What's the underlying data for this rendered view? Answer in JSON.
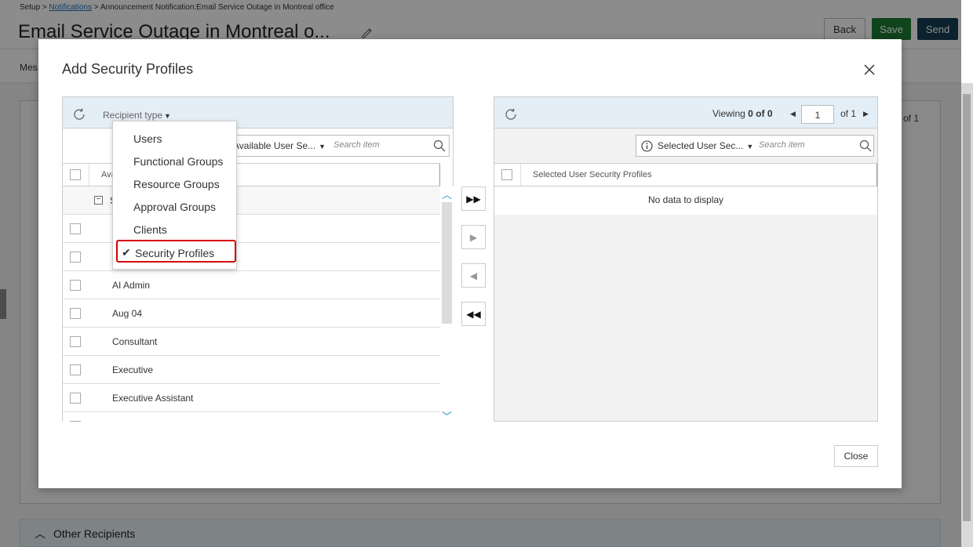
{
  "breadcrumb": {
    "root": "Setup",
    "sep1": ">",
    "link": "Notifications",
    "sep2": ">",
    "current": "Announcement Notification:Email Service Outage in Montreal office"
  },
  "page": {
    "title": "Email Service Outage in Montreal o...",
    "back_label": "Back",
    "save_label": "Save",
    "send_label": "Send",
    "tab_label_partial": "Mes",
    "other_recipients": "Other Recipients",
    "bg_pager": "of 1"
  },
  "modal": {
    "title": "Add Security Profiles",
    "close_label": "Close"
  },
  "left_panel": {
    "recipient_type_label": "Recipient type",
    "dropdown_label": "Available User Se...",
    "search_placeholder": "Search item",
    "column_header": "Ava",
    "group_label": "S",
    "rows": [
      "",
      "",
      "AI Admin",
      "Aug 04",
      "Consultant",
      "Executive",
      "Executive Assistant"
    ]
  },
  "right_panel": {
    "viewing_prefix": "Viewing",
    "viewing_count": "0 of 0",
    "page_number": "1",
    "page_of": "of 1",
    "dropdown_label": "Selected User Sec...",
    "search_placeholder": "Search item",
    "column_header": "Selected User Security Profiles",
    "no_data": "No data to display"
  },
  "recipient_menu": {
    "items": [
      "Users",
      "Functional Groups",
      "Resource Groups",
      "Approval Groups",
      "Clients",
      "Security Profiles"
    ],
    "selected": "Security Profiles"
  },
  "colors": {
    "save": "#1e7d34",
    "send": "#143e55",
    "panel_header": "#e4eef6",
    "highlight": "#d40000"
  }
}
